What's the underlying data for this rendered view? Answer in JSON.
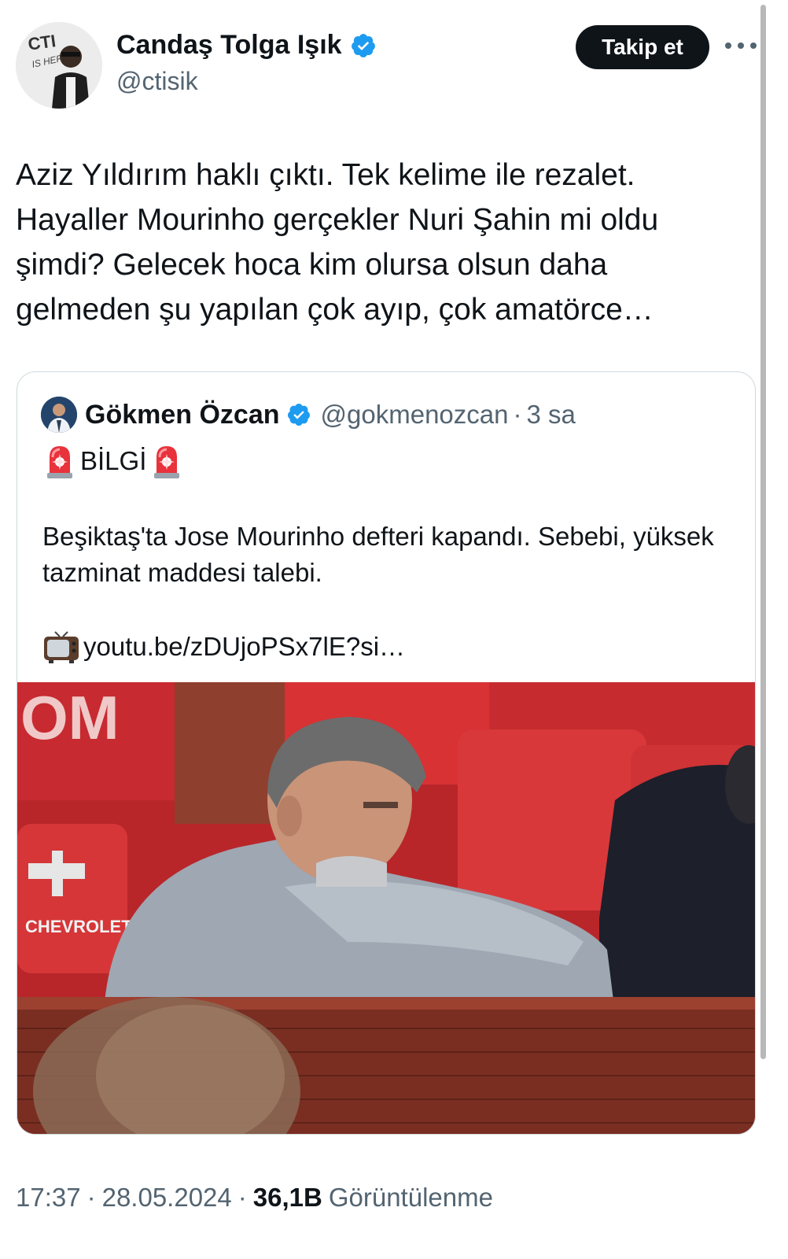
{
  "tweet": {
    "author": {
      "name": "Candaş Tolga Işık",
      "handle": "@ctisik",
      "avatar_logo_text": "CTI IS HERE"
    },
    "follow_label": "Takip et",
    "text": "Aziz Yıldırım haklı çıktı. Tek kelime ile rezalet.\nHayaller Mourinho gerçekler Nuri Şahin mi oldu\nşimdi? Gelecek hoca kim olursa olsun daha\ngelmeden şu yapılan çok ayıp, çok amatörce…",
    "time": "17:37",
    "date": "28.05.2024",
    "views_count": "36,1B",
    "views_label": "Görüntülenme"
  },
  "quote": {
    "author_name": "Gökmen Özcan",
    "handle": "@gokmenozcan",
    "separator": "·",
    "time_ago": "3 sa",
    "info_label": "BİLGİ",
    "body": "Beşiktaş'ta Jose Mourinho defteri kapandı. Sebebi, yüksek tazminat maddesi talebi.",
    "link": "youtu.be/zDUjoPSx7lE?si…",
    "photo_signage": {
      "stand_letters": "OM",
      "sponsor": "CHEVROLET"
    }
  },
  "colors": {
    "text_primary": "#0f1419",
    "text_secondary": "#536471",
    "verified_blue": "#1d9bf0",
    "border": "#cfd9de",
    "follow_bg": "#0f1419"
  },
  "icons": [
    "verified-badge-icon",
    "more-options-icon",
    "siren-icon",
    "television-icon"
  ]
}
